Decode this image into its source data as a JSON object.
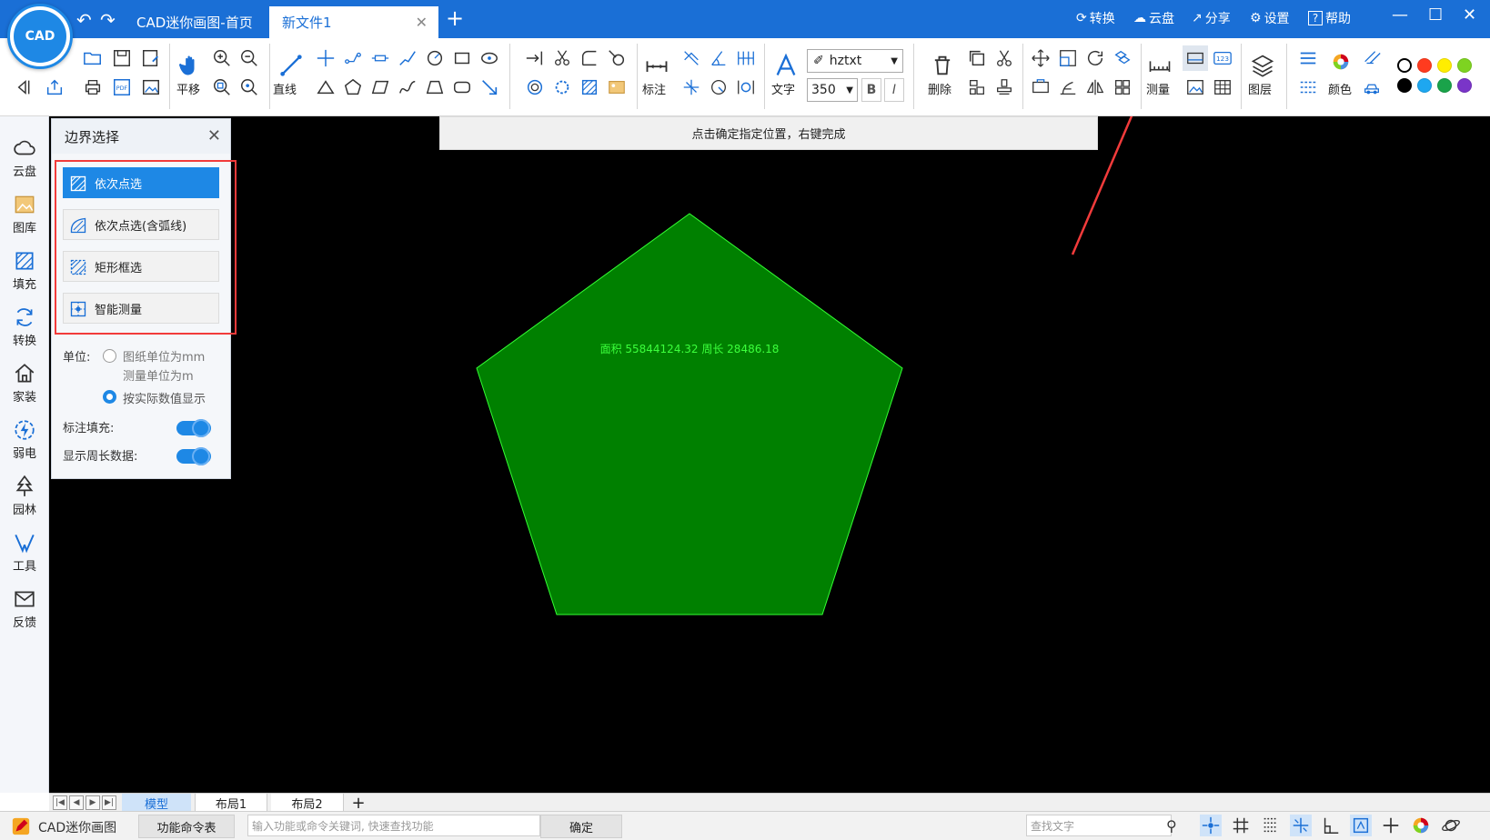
{
  "titlebar": {
    "tabs": [
      {
        "label": "CAD迷你画图-首页"
      },
      {
        "label": "新文件1"
      }
    ],
    "menu": {
      "convert": "转换",
      "cloud": "云盘",
      "share": "分享",
      "settings": "设置",
      "help": "帮助"
    }
  },
  "toolbar": {
    "pan": "平移",
    "line": "直线",
    "annotate": "标注",
    "text": "文字",
    "font_value": "hztxt",
    "size_value": "350",
    "bold": "B",
    "italic": "I",
    "delete": "删除",
    "measure": "测量",
    "layer": "图层",
    "color": "颜色",
    "pdf_label": "PDF",
    "count_label": "123"
  },
  "colors": {
    "swatches": [
      "#ffffff",
      "#ff3b1f",
      "#ffee00",
      "#7ed321",
      "#000000",
      "#1ea7f0",
      "#1aa34a",
      "#7a35c8"
    ],
    "accent": "#1a6fd6",
    "pentagon_fill": "#008000",
    "pentagon_text": "#3cff3c",
    "highlight": "#f23b3b"
  },
  "sidebar": {
    "items": [
      {
        "label": "云盘"
      },
      {
        "label": "图库"
      },
      {
        "label": "填充"
      },
      {
        "label": "转换"
      },
      {
        "label": "家装"
      },
      {
        "label": "弱电"
      },
      {
        "label": "园林"
      },
      {
        "label": "工具"
      },
      {
        "label": "反馈"
      }
    ]
  },
  "hint": "点击确定指定位置，右键完成",
  "panel": {
    "title": "边界选择",
    "options": [
      {
        "label": "依次点选"
      },
      {
        "label": "依次点选(含弧线)"
      },
      {
        "label": "矩形框选"
      },
      {
        "label": "智能测量"
      }
    ],
    "unit_label": "单位:",
    "unit_option1_line1": "图纸单位为mm",
    "unit_option1_line2": "测量单位为m",
    "unit_option2": "按实际数值显示",
    "fill_label": "标注填充:",
    "perimeter_label": "显示周长数据:"
  },
  "canvas": {
    "measure_text": "面积 55844124.32 周长 28486.18"
  },
  "layouts": {
    "tabs": [
      "模型",
      "布局1",
      "布局2"
    ]
  },
  "statusbar": {
    "app_name": "CAD迷你画图",
    "command_table": "功能命令表",
    "command_placeholder": "输入功能或命令关键词, 快速查找功能",
    "confirm": "确定",
    "search_placeholder": "查找文字"
  }
}
